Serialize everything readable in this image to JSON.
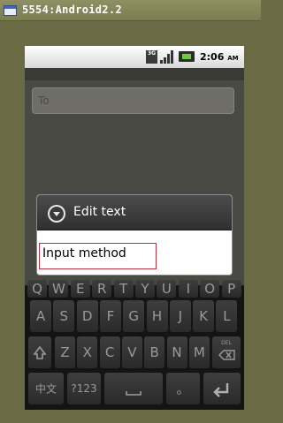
{
  "window": {
    "title": "5554:Android2.2"
  },
  "statusbar": {
    "network": "3G",
    "time": "2:06",
    "ampm": "AM"
  },
  "compose": {
    "to_placeholder": "To"
  },
  "dialog": {
    "title": "Edit text",
    "item": "Input method"
  },
  "keyboard": {
    "row1": [
      {
        "name": "key-q",
        "label": "Q"
      },
      {
        "name": "key-w",
        "label": "W"
      },
      {
        "name": "key-e",
        "label": "E"
      },
      {
        "name": "key-r",
        "label": "R"
      },
      {
        "name": "key-t",
        "label": "T"
      },
      {
        "name": "key-y",
        "label": "Y"
      },
      {
        "name": "key-u",
        "label": "U"
      },
      {
        "name": "key-i",
        "label": "I"
      },
      {
        "name": "key-o",
        "label": "O"
      },
      {
        "name": "key-p",
        "label": "P"
      }
    ],
    "row2": [
      {
        "name": "key-a",
        "label": "A"
      },
      {
        "name": "key-s",
        "label": "S"
      },
      {
        "name": "key-d",
        "label": "D"
      },
      {
        "name": "key-f",
        "label": "F"
      },
      {
        "name": "key-g",
        "label": "G"
      },
      {
        "name": "key-h",
        "label": "H"
      },
      {
        "name": "key-j",
        "label": "J"
      },
      {
        "name": "key-k",
        "label": "K"
      },
      {
        "name": "key-l",
        "label": "L"
      }
    ],
    "row3": [
      {
        "name": "key-z",
        "label": "Z"
      },
      {
        "name": "key-x",
        "label": "X"
      },
      {
        "name": "key-c",
        "label": "C"
      },
      {
        "name": "key-v",
        "label": "V"
      },
      {
        "name": "key-b",
        "label": "B"
      },
      {
        "name": "key-n",
        "label": "N"
      },
      {
        "name": "key-m",
        "label": "M"
      }
    ],
    "del_label": "DEL",
    "lang_label": "中文",
    "symbols_label": "?123",
    "period_label": "。",
    "shift_icon": "shift-icon",
    "backspace_icon": "backspace-icon",
    "space_icon": "space-icon",
    "enter_icon": "enter-icon"
  },
  "colors": {
    "dialog_selection_border": "#c0303a",
    "battery_fill": "#6ccc3c"
  }
}
